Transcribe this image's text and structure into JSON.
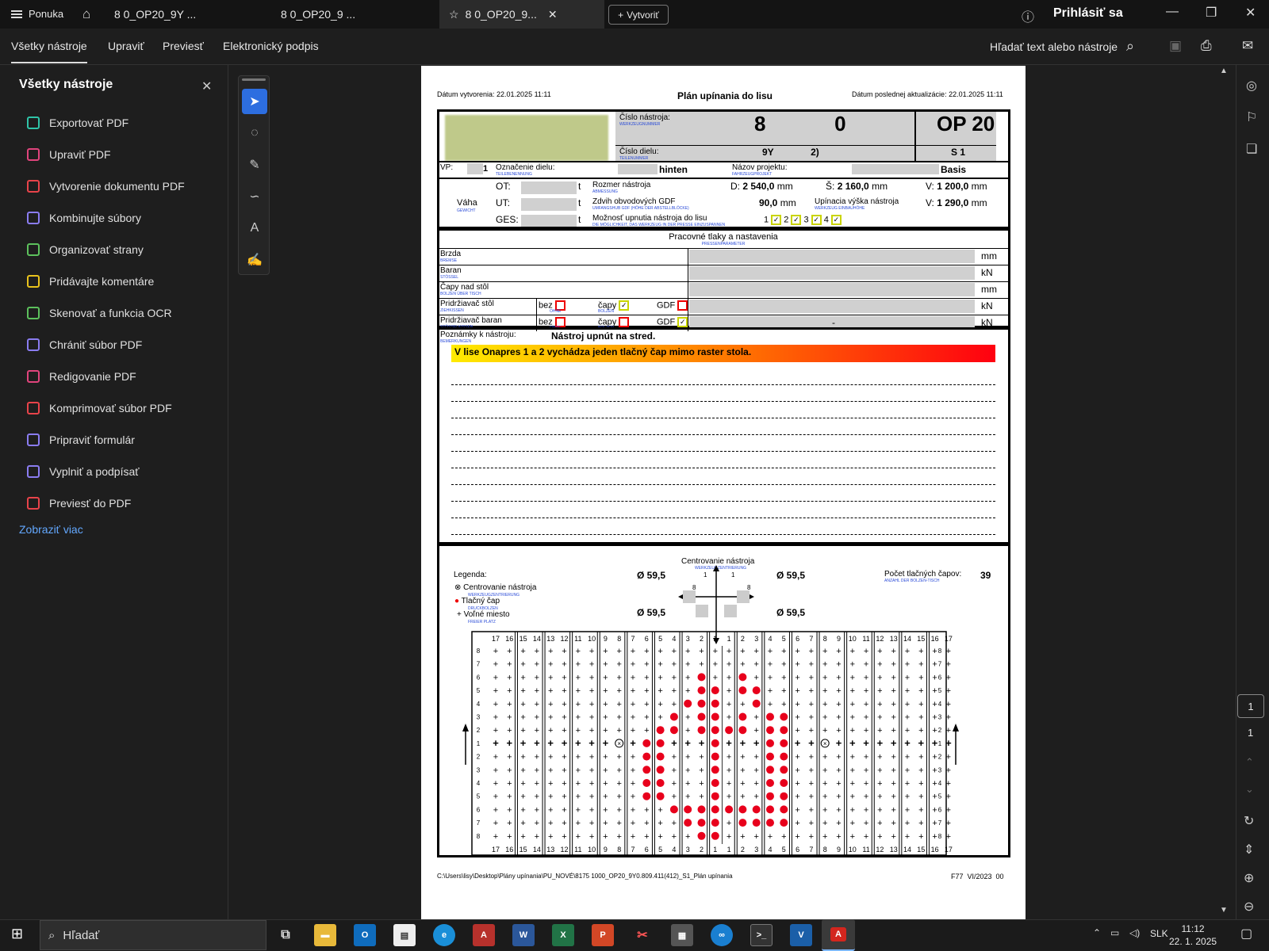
{
  "tabs": {
    "menu": "Ponuka",
    "tab1": "8          0_OP20_9Y         ...",
    "tab2": "8          0_OP20_9          ...",
    "tab3": "8          0_OP20_9...",
    "new": "Vytvoriť",
    "signin": "Prihlásiť sa"
  },
  "toolbar": {
    "all_tools": "Všetky nástroje",
    "edit": "Upraviť",
    "convert": "Previesť",
    "esign": "Elektronický podpis",
    "search": "Hľadať text alebo nástroje"
  },
  "sidebar": {
    "title": "Všetky nástroje",
    "show_more": "Zobraziť viac",
    "items": [
      {
        "label": "Exportovať PDF",
        "color": "#2fc4a8"
      },
      {
        "label": "Upraviť PDF",
        "color": "#e0447c"
      },
      {
        "label": "Vytvorenie dokumentu PDF",
        "color": "#e8434a"
      },
      {
        "label": "Kombinujte súbory",
        "color": "#8a7cf0"
      },
      {
        "label": "Organizovať strany",
        "color": "#5cc05c"
      },
      {
        "label": "Pridávajte komentáre",
        "color": "#e8c21c"
      },
      {
        "label": "Skenovať a funkcia OCR",
        "color": "#5cc05c"
      },
      {
        "label": "Chrániť súbor PDF",
        "color": "#8a7cf0"
      },
      {
        "label": "Redigovanie PDF",
        "color": "#e0447c"
      },
      {
        "label": "Komprimovať súbor PDF",
        "color": "#e8434a"
      },
      {
        "label": "Pripraviť formulár",
        "color": "#8a7cf0"
      },
      {
        "label": "Vyplniť a podpísať",
        "color": "#8a7cf0"
      },
      {
        "label": "Previesť do PDF",
        "color": "#e8434a"
      }
    ]
  },
  "page_nav": {
    "current": "1",
    "total": "1"
  },
  "taskbar": {
    "search": "Hľadať",
    "lang": "SLK",
    "time": "11:12",
    "date": "22. 1. 2025"
  },
  "doc": {
    "created": "Dátum vytvorenia: 22.01.2025 11:11",
    "title": "Plán upínania do lisu",
    "updated": "Dátum poslednej aktualizácie: 22.01.2025 11:11",
    "tool_no_label": "Číslo nástroja:",
    "tool_no_sub": "Werkzeugnummer",
    "tool_no": "8            0",
    "op": "OP 20",
    "part_no_label": "Číslo dielu:",
    "part_no_sub": "Teilenummer",
    "part_no": "9Y              2)",
    "s": "S 1",
    "vp_label": "VP:",
    "vp": "1",
    "part_name_label": "Označenie dielu:",
    "part_name_sub": "Teilebenennung",
    "part_name": "hinten",
    "project_label": "Názov projektu:",
    "project_sub": "Fahrzeugprojekt",
    "project": "Basis",
    "weight": "Váha",
    "weight_sub": "Gewicht",
    "ot": "OT:",
    "ut": "UT:",
    "ges": "GES:",
    "t": "t",
    "dim_label": "Rozmer nástroja",
    "dim_sub": "Abmessung",
    "d_lbl": "D:",
    "d": "2 540,0",
    "s_lbl": "Š:",
    "s_val": "2 160,0",
    "v_lbl": "V:",
    "v": "1 200,0",
    "mm": "mm",
    "gdf_label": "Zdvih obvodových GDF",
    "gdf_sub": "Umfangshub GDF (Höhe der Abstellblöcke)",
    "gdf": "90,0",
    "clamp_label": "Upínacia výška nástroja",
    "clamp_sub": "Werkzeug Einbauhöhe",
    "clamp_v": "1 290,0",
    "poss_label": "Možnosť upnutia nástroja do lisu",
    "poss_sub": "Die Möglichkeit, das Werkzeug in der Presse einzuspannen",
    "press_title": "Pracovné tlaky a nastavenia",
    "press_sub": "Pressenparameter",
    "rows": [
      {
        "label": "Brzda",
        "sub": "Bremse",
        "unit": "mm"
      },
      {
        "label": "Baran",
        "sub": "Stößel",
        "unit": "kN"
      },
      {
        "label": "Čapy nad stôl",
        "sub": "Bolzen über Tisch",
        "unit": "mm"
      },
      {
        "label": "Pridržiavač stôl",
        "sub": "Ziehkissen",
        "unit": "kN"
      },
      {
        "label": "Pridržiavač baran",
        "sub": "Stößelkissen",
        "unit": "kN"
      }
    ],
    "bez": "bez",
    "bez_sub": "Ohne",
    "capy": "čapy",
    "capy_sub": "Bolzen",
    "gdf_s": "GDF",
    "dash": "-",
    "notes_label": "Poznámky k nástroju:",
    "notes_sub": "Bemerkungen",
    "note1": "Nástroj upnút na stred.",
    "note_banner": "V lise Onapres 1 a 2 vychádza jeden tlačný čap mimo raster stola.",
    "legend": "Legenda:",
    "leg1": "Centrovanie nástroja",
    "leg1_sub": "Werkzeugzentrierung",
    "leg2": "Tlačný čap",
    "leg2_sub": "Druckbolzen",
    "leg3": "Voľné miesto",
    "leg3_sub": "Freier Platz",
    "center_title": "Centrovanie nástroja",
    "center_sub": "Werkzeugzentrierung",
    "dia": "Ø 59,5",
    "one": "1",
    "eight": "8",
    "count_label": "Počet tlačných čapov:",
    "count_sub": "Anzahl der Bolzen-Tisch",
    "count": "39",
    "path": "C:\\Users\\lisy\\Desktop\\Plány upínania\\PU_NOVÉ\\8175 1000_OP20_9Y0.809.411(412)_S1_Plán upínania",
    "form": "F77  VI/2023  00"
  }
}
